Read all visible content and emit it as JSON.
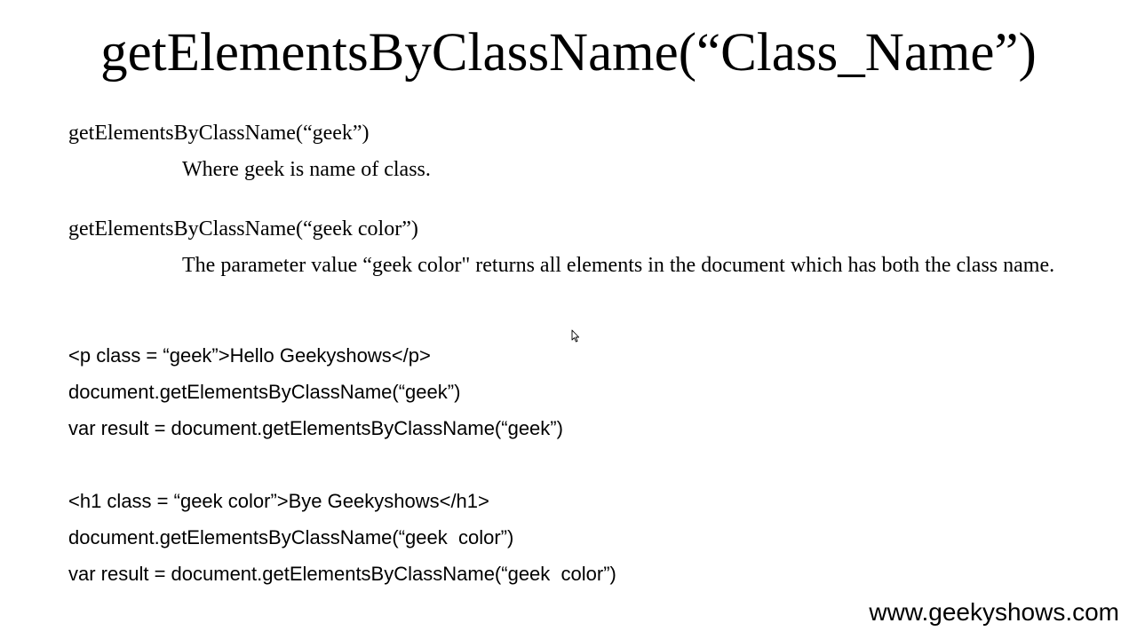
{
  "slide": {
    "title": "getElementsByClassName(“Class_Name”)",
    "examples": [
      {
        "signature": "getElementsByClassName(“geek”)",
        "description": "Where geek is name of class."
      },
      {
        "signature": "getElementsByClassName(“geek color”)",
        "description": "The parameter value “geek color\" returns all elements in the document which has both the class name."
      }
    ],
    "code_block_1": [
      "<p class = “geek”>Hello Geekyshows</p>",
      "document.getElementsByClassName(“geek”)",
      "var result = document.getElementsByClassName(“geek”)"
    ],
    "code_block_2": [
      "<h1 class = “geek color”>Bye Geekyshows</h1>",
      "document.getElementsByClassName(“geek  color”)",
      "var result = document.getElementsByClassName(“geek  color”)"
    ],
    "footer": "www.geekyshows.com"
  },
  "icons": {
    "cursor": "mouse-pointer-icon"
  }
}
